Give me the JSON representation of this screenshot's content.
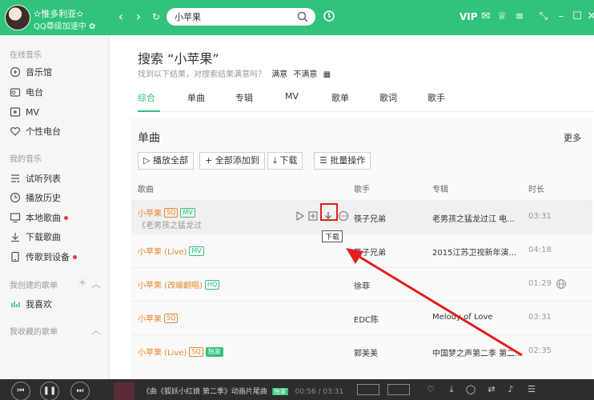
{
  "user": {
    "name": "✫惟多利亚✫",
    "level_text": "QQ尊级加速中",
    "diamond_icon": "diamond-icon"
  },
  "search": {
    "value": "小苹果",
    "placeholder": ""
  },
  "topbar": {
    "vip": "VIP"
  },
  "sidebar": {
    "online_header": "在线音乐",
    "online_items": [
      {
        "label": "音乐馆",
        "icon": "music-hall-icon"
      },
      {
        "label": "电台",
        "icon": "radio-icon"
      },
      {
        "label": "MV",
        "icon": "mv-icon"
      },
      {
        "label": "个性电台",
        "icon": "heart-radio-icon"
      }
    ],
    "my_header": "我的音乐",
    "my_items": [
      {
        "label": "试听列表",
        "icon": "list-icon"
      },
      {
        "label": "播放历史",
        "icon": "clock-icon"
      },
      {
        "label": "本地歌曲",
        "icon": "monitor-icon"
      },
      {
        "label": "下载歌曲",
        "icon": "download-icon"
      },
      {
        "label": "传歌到设备",
        "icon": "device-icon"
      }
    ],
    "created_header": "我创建的歌单",
    "created_items": [
      {
        "label": "我喜欢",
        "icon": "bars-icon"
      }
    ],
    "collected_header": "我收藏的歌单"
  },
  "main": {
    "title": "搜索 “小苹果”",
    "hint": "找到以下结果，对搜索结果满意吗？",
    "satisfied": "满意",
    "unsatisfied": "不满意",
    "tabs": [
      "综合",
      "单曲",
      "专辑",
      "MV",
      "歌单",
      "歌词",
      "歌手"
    ],
    "section_title": "单曲",
    "more": "更多",
    "buttons": [
      "播放全部",
      "全部添加到",
      "下载",
      "批量操作"
    ],
    "columns": [
      "歌曲",
      "歌手",
      "专辑",
      "时长"
    ],
    "rows": [
      {
        "title": "小苹果",
        "badges": [
          "SQ",
          "MV"
        ],
        "sub": "《老男孩之猛龙过",
        "artist": "筷子兄弟",
        "album": "老男孩之猛龙过江 电...",
        "duration": "03:31"
      },
      {
        "title": "小苹果 (Live)",
        "badges": [
          "MV"
        ],
        "artist": "筷子兄弟",
        "album": "2015江苏卫视新年演...",
        "duration": "04:18"
      },
      {
        "title": "小苹果 (改编翻唱)",
        "badges": [
          "HQ"
        ],
        "artist": "徐菲",
        "album": "",
        "duration": "01:29"
      },
      {
        "title": "小苹果",
        "badges": [
          "SQ"
        ],
        "artist": "EDC陈",
        "album": "Melody of Love",
        "duration": "03:31"
      },
      {
        "title": "小苹果 (Live)",
        "badges": [
          "SQ",
          "独家"
        ],
        "artist": "郭美美",
        "album": "中国梦之声第二季 第二...",
        "duration": "02:35"
      }
    ],
    "tooltip": "下载"
  },
  "player": {
    "track": "《曲《狐妖小红娘 第二季》动画片尾曲",
    "tag": "独家",
    "time": "00:56 / 03:31"
  },
  "colors": {
    "accent": "#31c27c",
    "song": "#e8862e",
    "highlight": "#e31f1f",
    "player_bg": "#2d2d2d"
  }
}
